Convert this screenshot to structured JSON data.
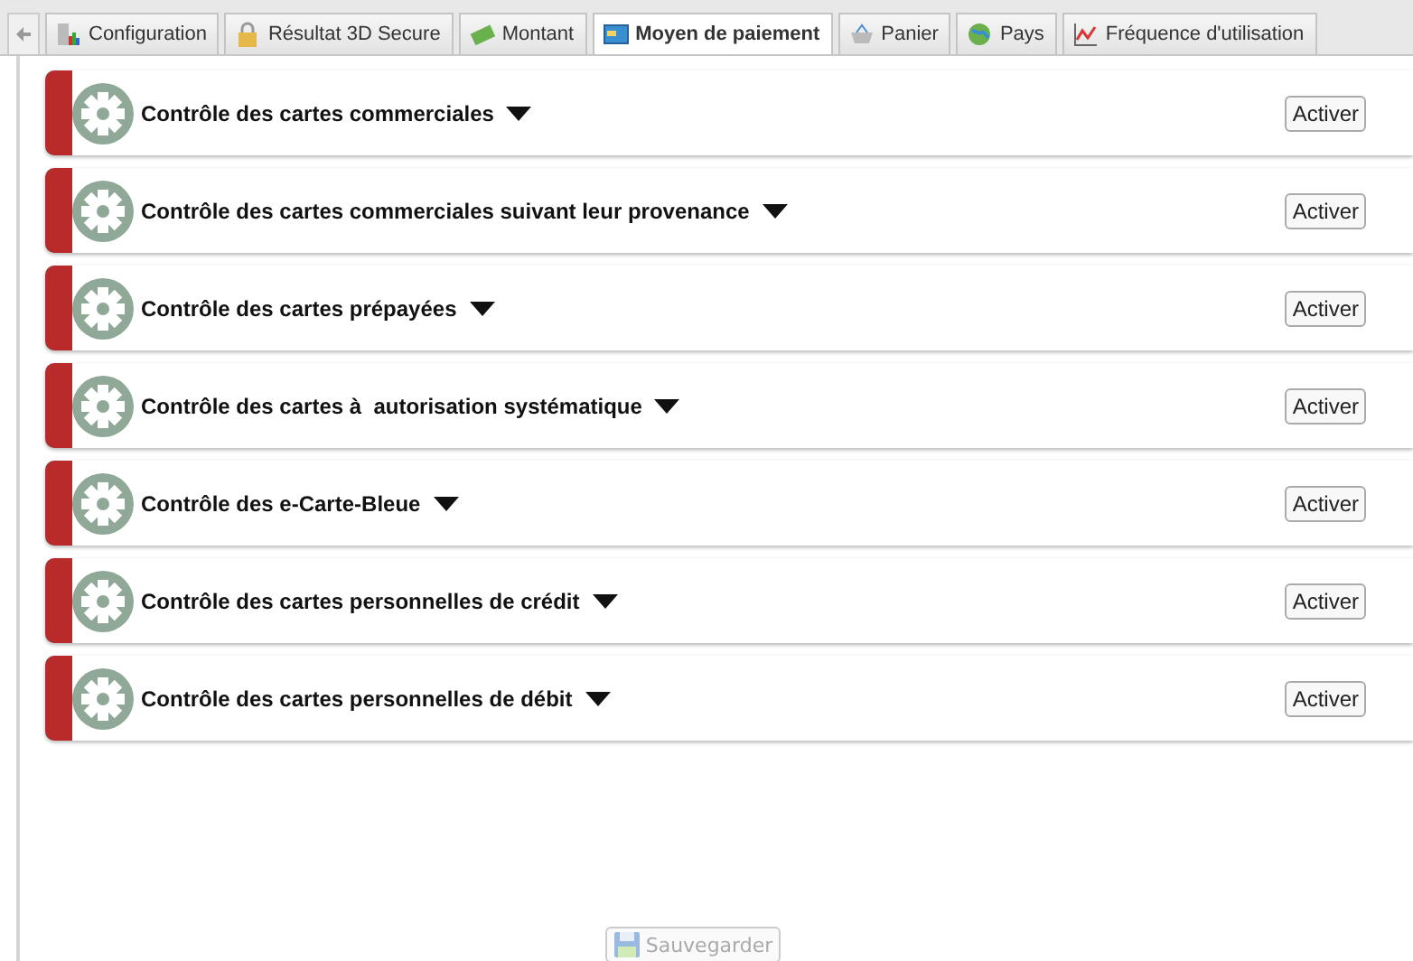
{
  "tabs": [
    {
      "label": "Configuration",
      "kind": "chart",
      "selected": false
    },
    {
      "label": "Résultat 3D Secure",
      "kind": "lock",
      "selected": false
    },
    {
      "label": "Montant",
      "kind": "money",
      "selected": false
    },
    {
      "label": "Moyen de paiement",
      "kind": "card",
      "selected": true
    },
    {
      "label": "Panier",
      "kind": "basket",
      "selected": false
    },
    {
      "label": "Pays",
      "kind": "globe",
      "selected": false
    },
    {
      "label": "Fréquence d'utilisation",
      "kind": "graph",
      "selected": false
    }
  ],
  "rules": [
    {
      "title": "Contrôle des cartes commerciales",
      "action": "Activer"
    },
    {
      "title": "Contrôle des cartes commerciales suivant leur provenance",
      "action": "Activer"
    },
    {
      "title": "Contrôle des cartes prépayées",
      "action": "Activer"
    },
    {
      "title": "Contrôle des cartes à  autorisation systématique",
      "action": "Activer"
    },
    {
      "title": "Contrôle des e-Carte-Bleue",
      "action": "Activer"
    },
    {
      "title": "Contrôle des cartes personnelles de crédit",
      "action": "Activer"
    },
    {
      "title": "Contrôle des cartes personnelles de débit",
      "action": "Activer"
    }
  ],
  "save_button": {
    "label": "Sauvegarder",
    "disabled": true
  }
}
